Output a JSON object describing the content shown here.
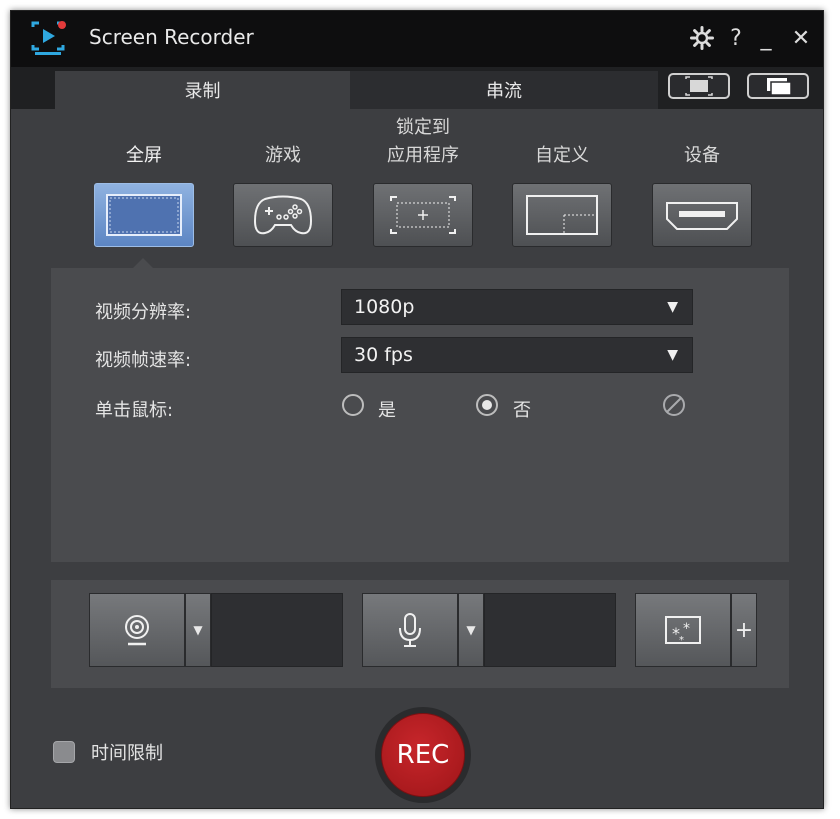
{
  "window": {
    "title": "Screen Recorder"
  },
  "titlebar": {
    "help_label": "?",
    "minimize_label": "_",
    "close_label": "✕"
  },
  "tabs": [
    {
      "label": "录制",
      "active": true
    },
    {
      "label": "串流",
      "active": false
    }
  ],
  "modes": [
    {
      "label": "全屏",
      "icon": "fullscreen-icon",
      "selected": true
    },
    {
      "label": "游戏",
      "icon": "gamepad-icon",
      "selected": false
    },
    {
      "label_line1": "锁定到",
      "label_line2": "应用程序",
      "icon": "lock-app-icon",
      "selected": false
    },
    {
      "label": "自定义",
      "icon": "custom-area-icon",
      "selected": false
    },
    {
      "label": "设备",
      "icon": "hdmi-icon",
      "selected": false
    }
  ],
  "settings": {
    "resolution_label": "视频分辨率:",
    "resolution_value": "1080p",
    "framerate_label": "视频帧速率:",
    "framerate_value": "30 fps",
    "mouse_click_label": "单击鼠标:",
    "option_yes": "是",
    "option_no": "否",
    "mouse_click_value": "否"
  },
  "bottom": {
    "time_limit_label": "时间限制",
    "time_limit_checked": false,
    "rec_label": "REC"
  },
  "colors": {
    "window_bg": "#3d3e41",
    "selected_mode": "#6d94cf",
    "rec": "#b51d22",
    "accent_logo": "#2fa8e0"
  }
}
